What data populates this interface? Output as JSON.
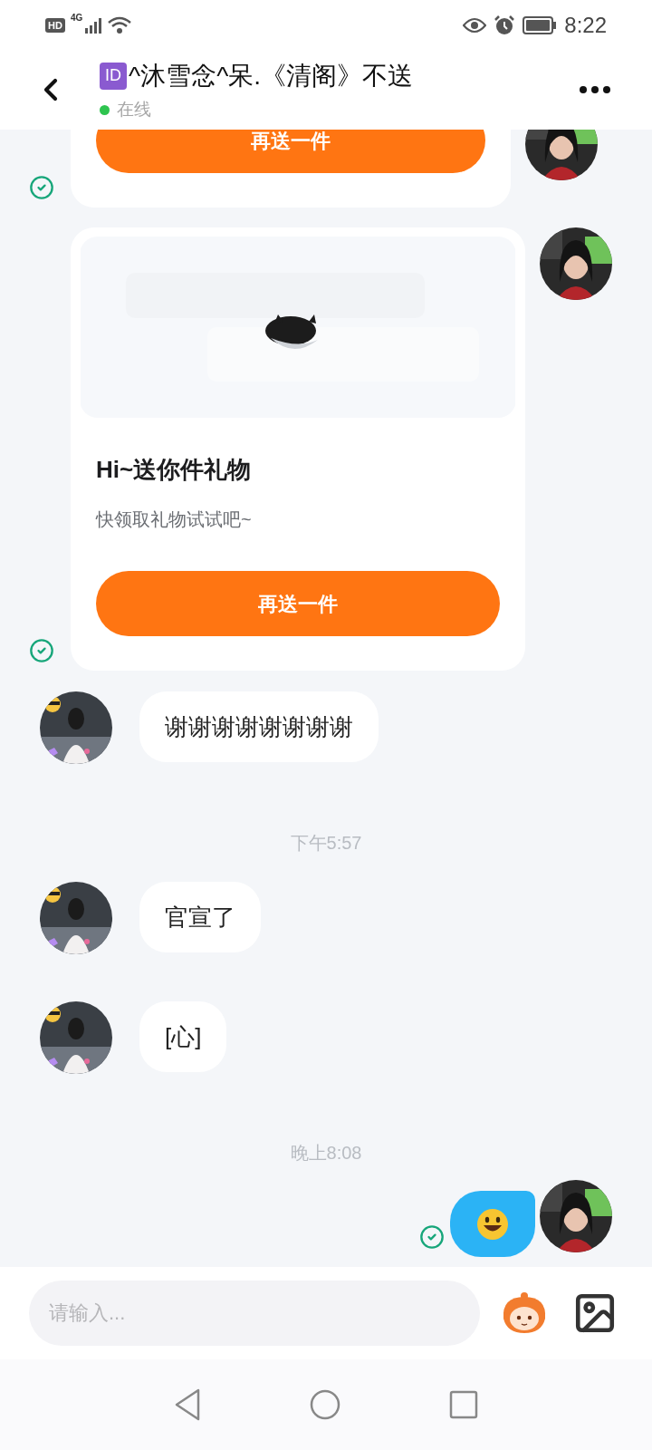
{
  "status_bar": {
    "hd": "HD",
    "network": "4G",
    "time": "8:22"
  },
  "header": {
    "badge": "ID",
    "title": "^沐雪念^呆.《清阁》不送",
    "online": true,
    "status": "在线"
  },
  "messages": [
    {
      "kind": "gift_card",
      "outgoing": true,
      "read": true,
      "button": "再送一件"
    },
    {
      "kind": "gift_card",
      "outgoing": true,
      "read": true,
      "image": true,
      "title": "Hi~送你件礼物",
      "subtitle": "快领取礼物试试吧~",
      "button": "再送一件"
    },
    {
      "kind": "text",
      "outgoing": false,
      "text": "谢谢谢谢谢谢谢谢"
    },
    {
      "kind": "time",
      "text": "下午5:57"
    },
    {
      "kind": "text",
      "outgoing": false,
      "text": "官宣了"
    },
    {
      "kind": "text",
      "outgoing": false,
      "text": "[心]"
    },
    {
      "kind": "time",
      "text": "晚上8:08"
    },
    {
      "kind": "emoji",
      "outgoing": true,
      "read": true
    }
  ],
  "composer": {
    "placeholder": "请输入..."
  }
}
